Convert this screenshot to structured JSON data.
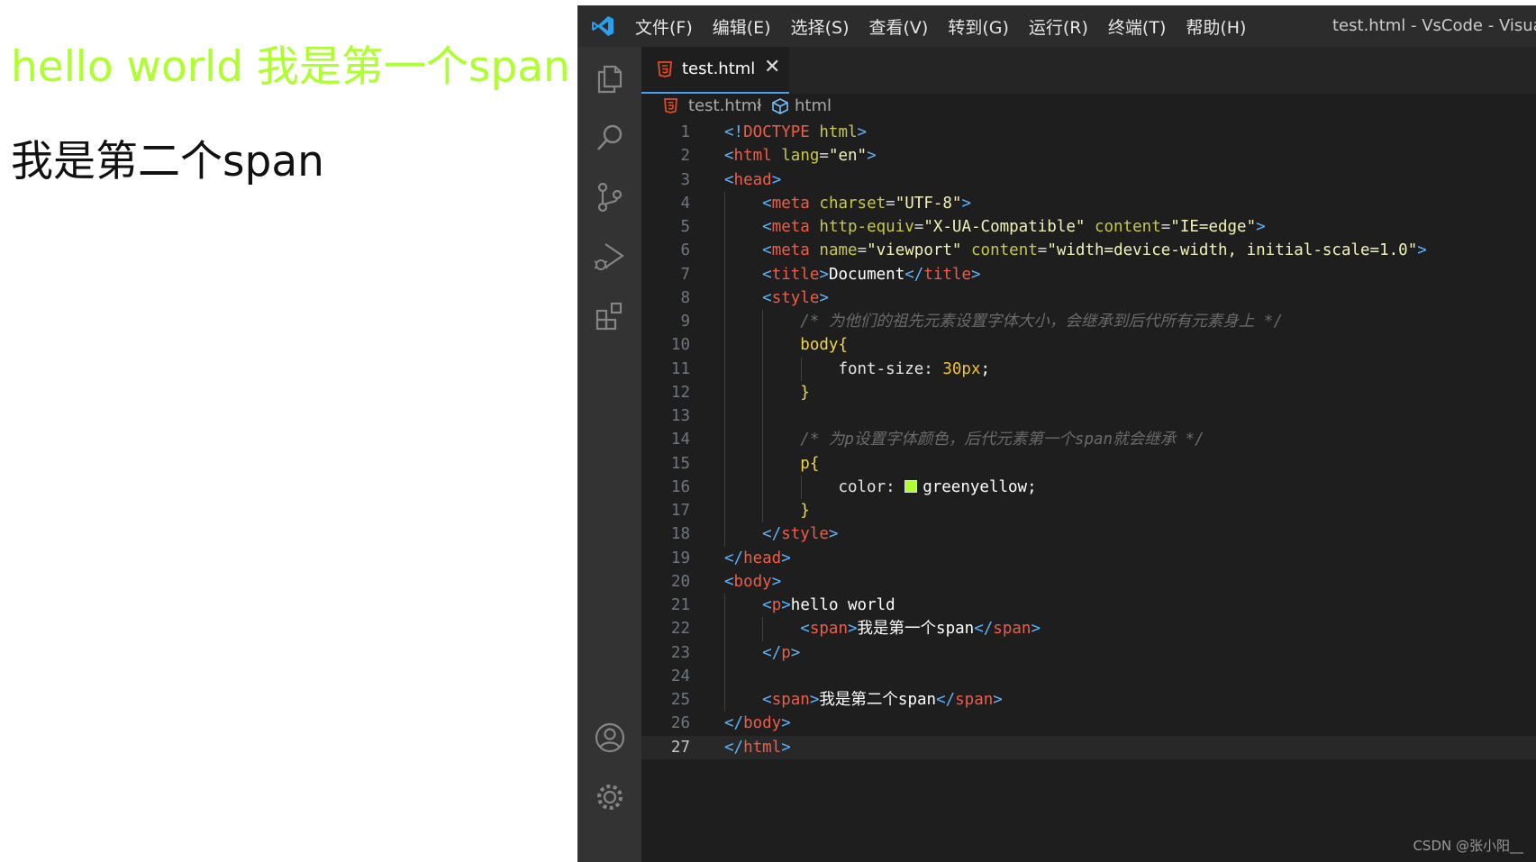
{
  "preview": {
    "p_text": "hello world ",
    "p_span": "我是第一个span",
    "span2": "我是第二个span",
    "p_color": "#adff2f"
  },
  "titlebar": {
    "icon": "vscode-logo-icon",
    "menus": [
      "文件(F)",
      "编辑(E)",
      "选择(S)",
      "查看(V)",
      "转到(G)",
      "运行(R)",
      "终端(T)",
      "帮助(H)"
    ],
    "window_title": "test.html - VsCode - Visual S"
  },
  "activity_bar": {
    "icons": [
      "explorer-icon",
      "search-icon",
      "source-control-icon",
      "run-debug-icon",
      "extensions-icon",
      "account-icon",
      "settings-gear-icon"
    ]
  },
  "tab": {
    "name": "test.html",
    "close": "✕",
    "icon": "html5-icon"
  },
  "breadcrumb": {
    "file": "test.html",
    "separator": "›",
    "node": "html",
    "node_icon": "element-cube-icon"
  },
  "editor": {
    "current_line": 27,
    "lines": [
      "<!DOCTYPE html>",
      "<html lang=\"en\">",
      "<head>",
      "    <meta charset=\"UTF-8\">",
      "    <meta http-equiv=\"X-UA-Compatible\" content=\"IE=edge\">",
      "    <meta name=\"viewport\" content=\"width=device-width, initial-scale=1.0\">",
      "    <title>Document</title>",
      "    <style>",
      "        /* 为他们的祖先元素设置字体大小，会继承到后代所有元素身上 */",
      "        body{",
      "            font-size: 30px;",
      "        }",
      "",
      "        /* 为p设置字体颜色，后代元素第一个span就会继承 */",
      "        p{",
      "            color: greenyellow;",
      "        }",
      "    </style>",
      "</head>",
      "<body>",
      "    <p>hello world",
      "        <span>我是第一个span</span>",
      "    </p>",
      "",
      "    <span>我是第二个span</span>",
      "</body>",
      "</html>"
    ]
  },
  "watermark": "CSDN @张小阳__"
}
